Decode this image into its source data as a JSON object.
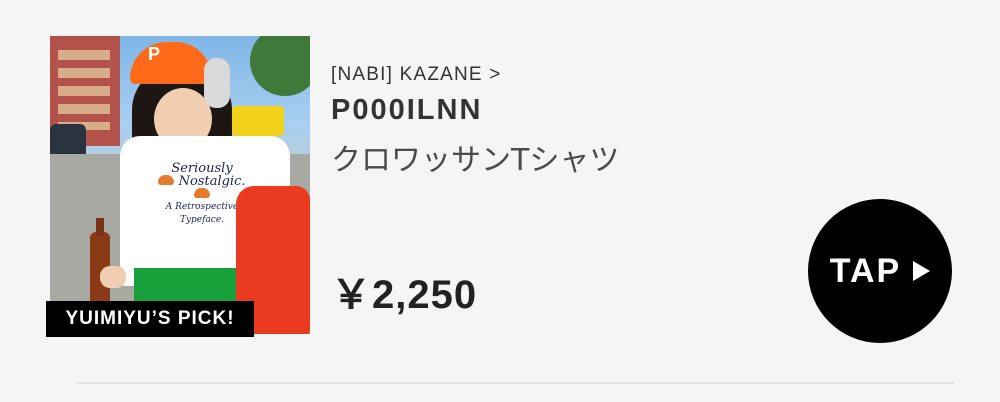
{
  "badge": {
    "label": "YUIMIYU’S PICK!"
  },
  "product": {
    "brand_link": "[NABI] KAZANE >",
    "code": "P000ILNN",
    "name": "クロワッサンTシャツ",
    "price": "￥2,250",
    "image_icon": "product-photo",
    "tee_print": [
      "Seriously",
      "Nostalgic.",
      "A Retrospective Typeface."
    ]
  },
  "cta": {
    "label": "TAP",
    "icon": "play-triangle-icon",
    "color": "#000000"
  },
  "colors": {
    "accent": "#000000",
    "background": "#f5f5f5",
    "cap": "#ff6a1a",
    "bag": "#ea3b21",
    "pants": "#18a13a"
  }
}
